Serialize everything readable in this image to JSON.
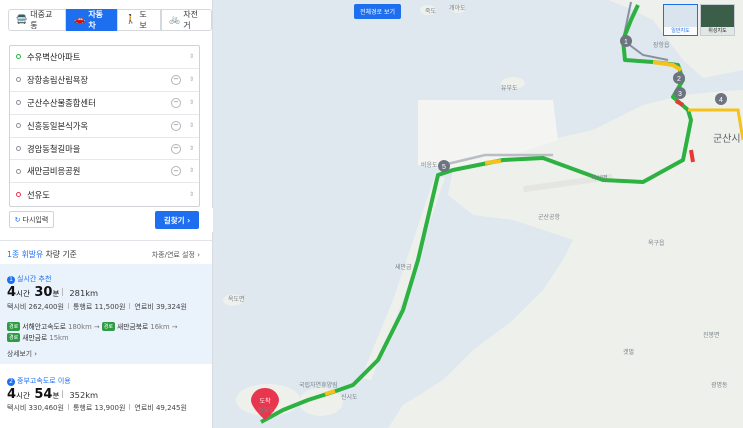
{
  "modes": [
    {
      "label": "대중교통",
      "icon": "bus-icon"
    },
    {
      "label": "자동차",
      "icon": "car-icon",
      "active": true
    },
    {
      "label": "도보",
      "icon": "walk-icon"
    },
    {
      "label": "자전거",
      "icon": "bicycle-icon"
    }
  ],
  "stops": [
    {
      "label": "수유벽산아파트",
      "kind": "start"
    },
    {
      "label": "장항송림산림욕장",
      "kind": "via"
    },
    {
      "label": "군산수산물종합센터",
      "kind": "via"
    },
    {
      "label": "신흥동일본식가옥",
      "kind": "via"
    },
    {
      "label": "경암동철길마을",
      "kind": "via"
    },
    {
      "label": "새만금비응공원",
      "kind": "via"
    },
    {
      "label": "선유도",
      "kind": "end"
    }
  ],
  "controls": {
    "reset_label": "다시입력",
    "search_label": "길찾기",
    "remove_symbol": "−",
    "drag_symbol": "⇕",
    "close_symbol": "✕",
    "collapse_symbol": "‹"
  },
  "basis": {
    "prefix": "1종 휘발유",
    "suffix": " 차량 기준",
    "settings_label": "차종/연료 설정"
  },
  "routes": [
    {
      "num": "1",
      "title": "실시간 추천",
      "hours": "4",
      "hours_unit": "시간",
      "minutes": "30",
      "minutes_unit": "분",
      "distance": "281km",
      "taxi": "택시비 262,400원",
      "toll": "통행료 11,500원",
      "fuel": "연료비 39,324원",
      "roads": [
        {
          "tag": "경로",
          "name": "서해안고속도로",
          "km": "180km"
        },
        {
          "tag": "경로",
          "name": "새만금북로",
          "km": "16km"
        },
        {
          "tag": "경로",
          "name": "새만금로",
          "km": "15km"
        }
      ],
      "more_label": "상세보기"
    },
    {
      "num": "2",
      "title": "중부고속도로 이용",
      "hours": "4",
      "hours_unit": "시간",
      "minutes": "54",
      "minutes_unit": "분",
      "distance": "352km",
      "taxi": "택시비 330,460원",
      "toll": "통행료 13,900원",
      "fuel": "연료비 49,245원"
    }
  ],
  "map": {
    "full_route_label": "전체경로 보기",
    "map_types": [
      "일반지도",
      "위성지도"
    ],
    "labels": {
      "okseo": "옥서면",
      "okgu": "옥구읍",
      "gunsan": "군산시",
      "gunsan_airport": "군산공항",
      "saemangeum": "새만금",
      "sinsido": "신시도",
      "seonyu": "선유도",
      "janghang": "장항읍",
      "biung": "비응도",
      "yubudo": "유부도",
      "gaeyado": "개야도",
      "jukdo": "죽도",
      "okdo": "옥도면",
      "hoehyeon": "회현면",
      "gwangjeong": "광명동",
      "sinsi_nat": "국립자연휴양림",
      "destination": "도착",
      "jinbongmyeon": "진봉면",
      "gyeokdo": "갯벌",
      "sanbuk": "산북동",
      "waypoints": [
        "1",
        "2",
        "3",
        "4",
        "5"
      ]
    }
  }
}
